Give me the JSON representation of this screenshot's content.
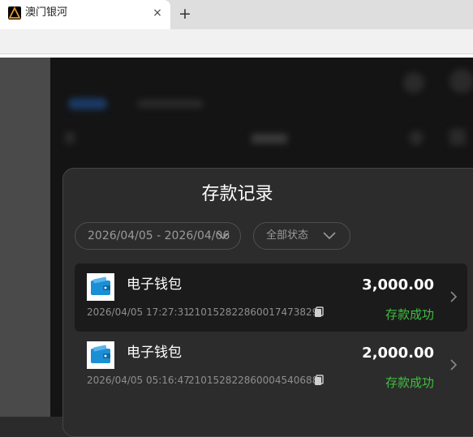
{
  "browser": {
    "tab_title": "澳门银河",
    "close_glyph": "×",
    "new_tab_glyph": "+"
  },
  "modal": {
    "title": "存款记录",
    "date_range": "2026/04/05 - 2026/04/06",
    "status_filter": "全部状态"
  },
  "records": [
    {
      "method": "电子钱包",
      "amount": "3,000.00",
      "datetime": "2026/04/05 17:27:31",
      "order_id": "210152822860017473829",
      "status": "存款成功",
      "icon": "wallet-icon",
      "selected": true
    },
    {
      "method": "电子钱包",
      "amount": "2,000.00",
      "datetime": "2026/04/05 05:16:47",
      "order_id": "210152822860004540688",
      "status": "存款成功",
      "icon": "wallet-icon",
      "selected": false
    }
  ],
  "colors": {
    "success": "#3fbf3f",
    "wallet_blue": "#1b8fd6",
    "modal_bg": "#2c2c2c"
  }
}
